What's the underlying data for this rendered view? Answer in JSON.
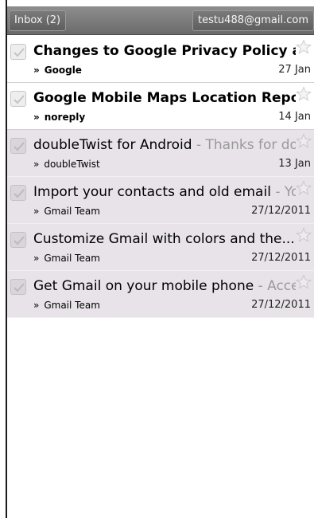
{
  "header": {
    "inbox_label": "Inbox (2)",
    "account": "testu488@gmail.com"
  },
  "messages": [
    {
      "subject": "Changes to Google Privacy Policy a...",
      "snippet": "",
      "sender": "Google",
      "date": "27 Jan",
      "unread": true
    },
    {
      "subject": "Google Mobile Maps Location Repo...",
      "snippet": "",
      "sender": "noreply",
      "date": "14 Jan",
      "unread": true
    },
    {
      "subject": "doubleTwist for Android",
      "snippet": " - Thanks for do...",
      "sender": "doubleTwist",
      "date": "13 Jan",
      "unread": false
    },
    {
      "subject": "Import your contacts and old email",
      "snippet": " - Yo...",
      "sender": "Gmail Team",
      "date": "27/12/2011",
      "unread": false
    },
    {
      "subject": "Customize Gmail with colors and the...",
      "snippet": " -...",
      "sender": "Gmail Team",
      "date": "27/12/2011",
      "unread": false
    },
    {
      "subject": "Get Gmail on your mobile phone",
      "snippet": " - Acce...",
      "sender": "Gmail Team",
      "date": "27/12/2011",
      "unread": false
    }
  ],
  "sender_prefix": "»",
  "icons": {
    "checkbox": "checkmark-icon",
    "star": "star-icon"
  },
  "colors": {
    "header": "#7d7d7d",
    "read_row": "#e7e3e8",
    "snippet": "#9a9a9a"
  }
}
